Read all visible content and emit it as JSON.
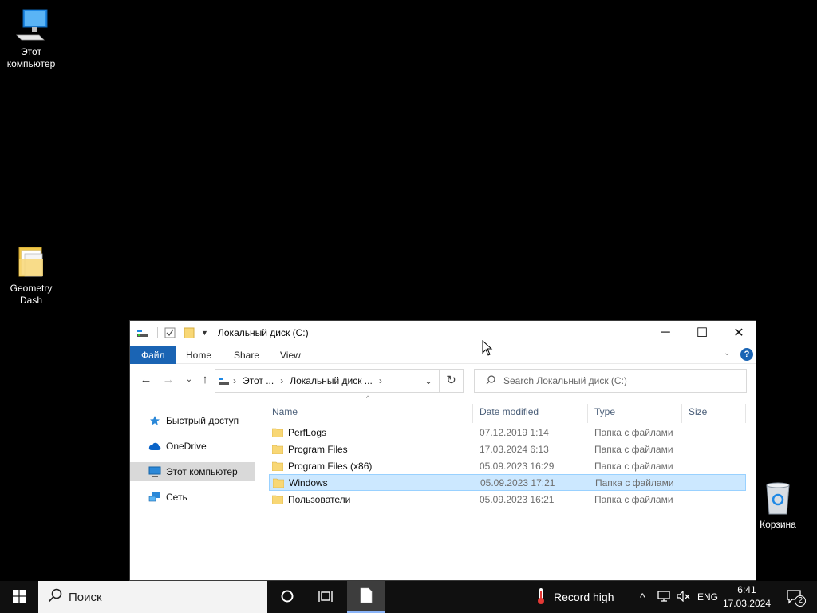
{
  "desktop": {
    "icons": [
      {
        "label_line1": "Этот",
        "label_line2": "компьютер",
        "icon": "computer-icon"
      },
      {
        "label_line1": "Geometry",
        "label_line2": "Dash",
        "icon": "folder-icon"
      },
      {
        "label_line1": "Корзина",
        "label_line2": "",
        "icon": "recycle-bin-icon"
      }
    ]
  },
  "explorer": {
    "title": "Локальный диск (C:)",
    "ribbon_tabs": [
      "Файл",
      "Home",
      "Share",
      "View"
    ],
    "address": {
      "segments": [
        "Этот ...",
        "Локальный диск ..."
      ]
    },
    "search_placeholder": "Search Локальный диск (C:)",
    "nav_items": [
      {
        "label": "Быстрый доступ",
        "icon": "star-icon",
        "selected": false
      },
      {
        "label": "OneDrive",
        "icon": "cloud-icon",
        "selected": false
      },
      {
        "label": "Этот компьютер",
        "icon": "computer-icon",
        "selected": true
      },
      {
        "label": "Сеть",
        "icon": "network-icon",
        "selected": false
      }
    ],
    "columns": [
      "Name",
      "Date modified",
      "Type",
      "Size"
    ],
    "files": [
      {
        "name": "PerfLogs",
        "date": "07.12.2019 1:14",
        "type": "Папка с файлами",
        "selected": false
      },
      {
        "name": "Program Files",
        "date": "17.03.2024 6:13",
        "type": "Папка с файлами",
        "selected": false
      },
      {
        "name": "Program Files (x86)",
        "date": "05.09.2023 16:29",
        "type": "Папка с файлами",
        "selected": false
      },
      {
        "name": "Windows",
        "date": "05.09.2023 17:21",
        "type": "Папка с файлами",
        "selected": true
      },
      {
        "name": "Пользователи",
        "date": "05.09.2023 16:21",
        "type": "Папка с файлами",
        "selected": false
      }
    ]
  },
  "taskbar": {
    "search_placeholder": "Поиск",
    "weather_text": "Record high",
    "language": "ENG",
    "time": "6:41",
    "date": "17.03.2024",
    "notification_count": "2"
  },
  "colors": {
    "accent": "#1a64b4",
    "selection": "#cce8ff",
    "folder": "#f8d775"
  }
}
